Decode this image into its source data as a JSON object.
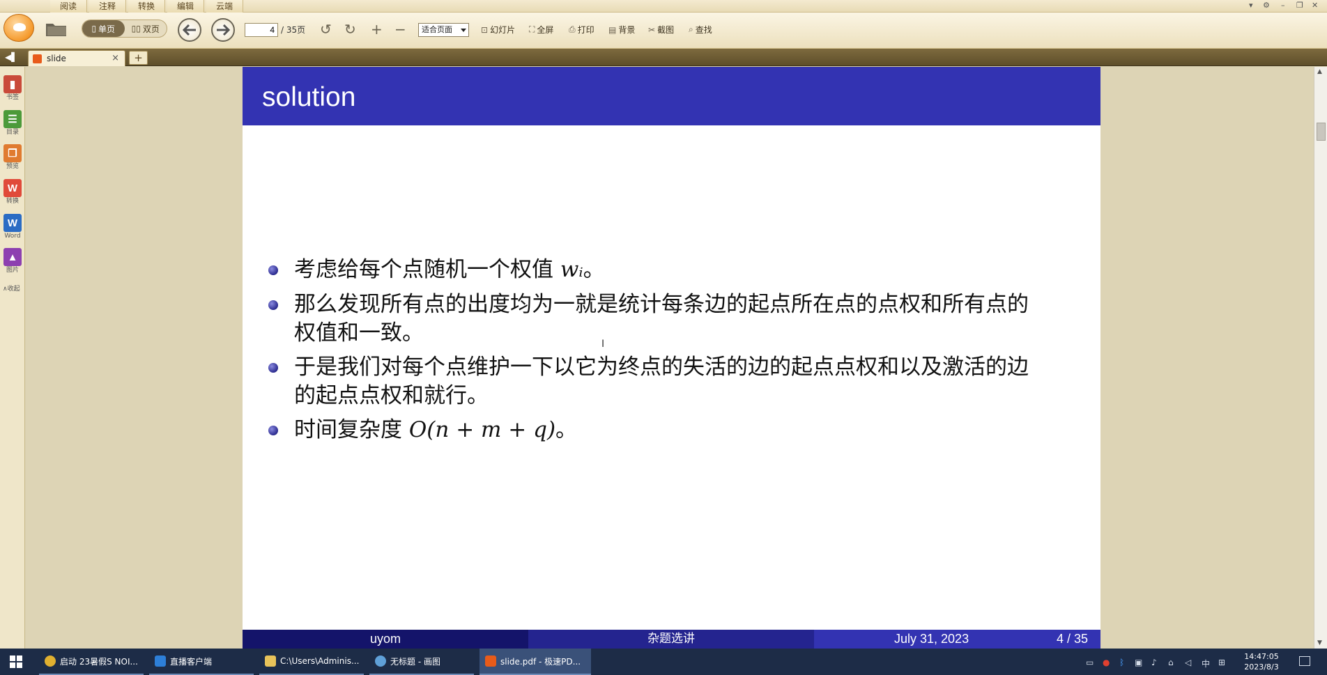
{
  "menu": {
    "tabs": [
      "阅读",
      "注释",
      "转换",
      "编辑",
      "云端"
    ]
  },
  "toolbar": {
    "single_page": "单页",
    "double_page": "双页",
    "page_current": "4",
    "page_total": "/ 35页",
    "zoom": "适合页面",
    "actions": {
      "slideshow": "幻灯片",
      "fullscreen": "全屏",
      "print": "打印",
      "background": "背景",
      "screenshot": "截图",
      "find": "查找"
    }
  },
  "tab": {
    "title": "slide",
    "close": "×",
    "new": "+"
  },
  "sidebar": {
    "items": [
      {
        "label": "书签",
        "icon": "bookmark-icon",
        "color": "#c94a3a"
      },
      {
        "label": "目录",
        "icon": "outline-icon",
        "color": "#4c9a3a"
      },
      {
        "label": "预览",
        "icon": "thumbnail-icon",
        "color": "#e07b30"
      },
      {
        "label": "转换",
        "icon": "convert-icon",
        "color": "#e04a3a"
      },
      {
        "label": "Word",
        "icon": "word-icon",
        "color": "#2b6cc4"
      },
      {
        "label": "图片",
        "icon": "image-icon",
        "color": "#8d3fb0"
      }
    ],
    "collapse": "∧收起"
  },
  "slide": {
    "title": "solution",
    "bullets": [
      {
        "text": "考虑给每个点随机一个权值 ",
        "math": "wᵢ",
        "after": "。"
      },
      {
        "text": "那么发现所有点的出度均为一就是统计每条边的起点所在点的点权和所有点的权值和一致。",
        "math": "",
        "after": ""
      },
      {
        "text": "于是我们对每个点维护一下以它为终点的失活的边的起点点权和以及激活的边的起点点权和就行。",
        "math": "",
        "after": ""
      },
      {
        "text": "时间复杂度 ",
        "math": "O(n + m + q)",
        "after": "。"
      }
    ],
    "footer": {
      "author": "uyom",
      "title": "杂题选讲",
      "date": "July 31, 2023",
      "page": "4 / 35"
    }
  },
  "taskbar": {
    "items": [
      {
        "label": "启动 23暑假S NOI...",
        "color": "#e0b030"
      },
      {
        "label": "直播客户端",
        "color": "#2d7fd8"
      },
      {
        "label": "C:\\Users\\Adminis...",
        "color": "#e8c35a"
      },
      {
        "label": "无标题 - 画图",
        "color": "#5fa0d8"
      },
      {
        "label": "slide.pdf - 极速PD...",
        "color": "#e85b1a"
      }
    ],
    "tray": {
      "ime": "中",
      "time": "14:47:05",
      "date": "2023/8/3"
    }
  },
  "colors": {
    "slide_header": "#3333b2",
    "footer_dark": "#14146a",
    "footer_mid": "#24248f",
    "app_bg": "#ddd4b5"
  }
}
